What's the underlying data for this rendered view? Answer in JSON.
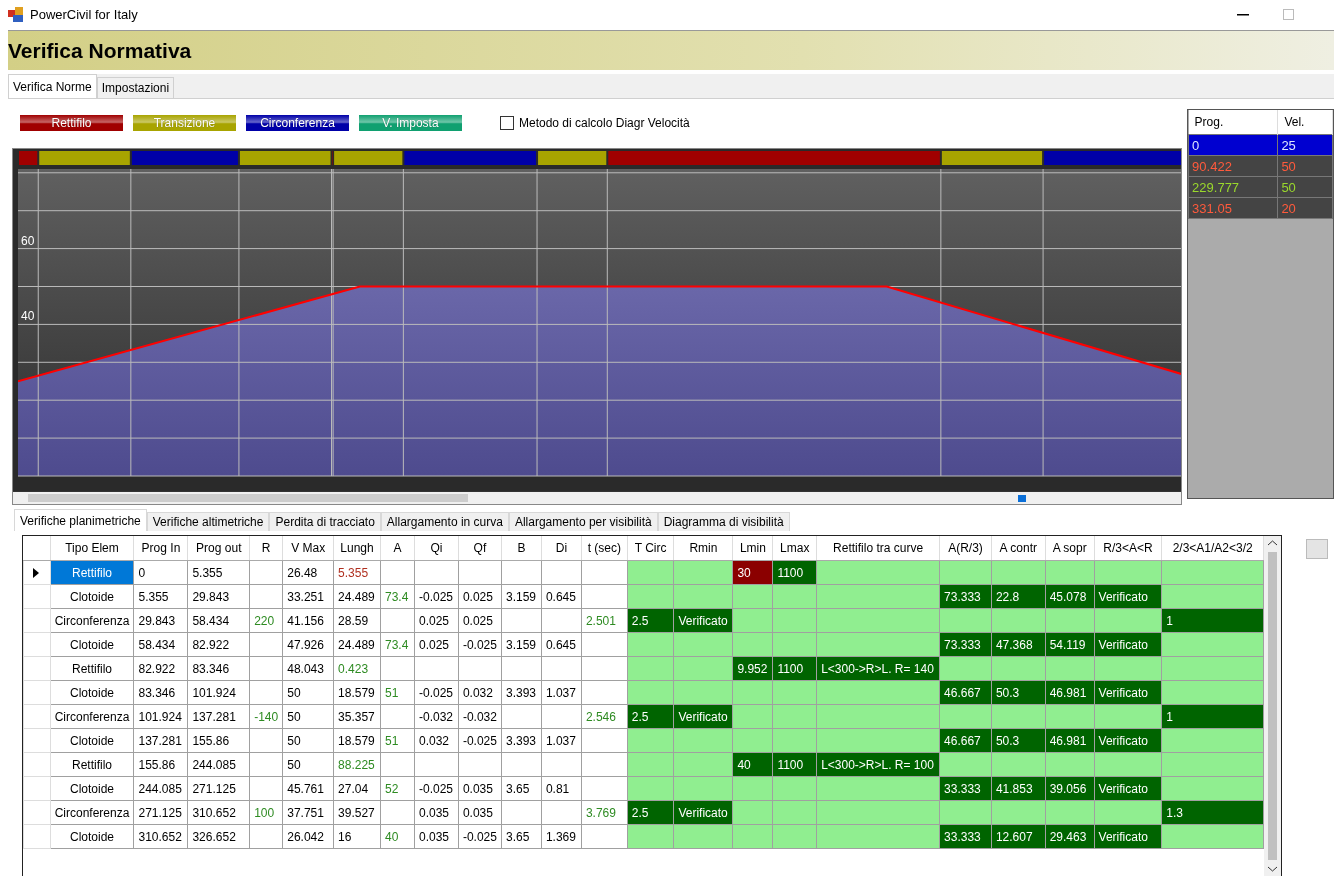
{
  "window": {
    "title": "PowerCivil for Italy"
  },
  "banner": {
    "title": "Verifica Normativa"
  },
  "tabs": [
    {
      "label": "Verifica Norme",
      "selected": true
    },
    {
      "label": "Impostazioni",
      "selected": false
    }
  ],
  "legend": [
    {
      "label": "Rettifilo",
      "color": "#a00000"
    },
    {
      "label": "Transizione",
      "color": "#a8a400"
    },
    {
      "label": "Circonferenza",
      "color": "#0000a8"
    },
    {
      "label": "V. Imposta",
      "color": "#10a070"
    }
  ],
  "speed_method": {
    "label": "Metodo di calcolo Diagr Velocità",
    "checked": false
  },
  "diagram": {
    "axis_labels": [
      "60",
      "40"
    ]
  },
  "speed_table": {
    "columns": [
      "Prog.",
      "Vel."
    ],
    "rows": [
      {
        "cells": [
          "0",
          "25"
        ],
        "selected": true
      },
      {
        "cells": [
          "90.422",
          "50"
        ],
        "selected": false,
        "color": "#ff5a3c"
      },
      {
        "cells": [
          "229.777",
          "50"
        ],
        "selected": false,
        "color": "#9ad82c"
      },
      {
        "cells": [
          "331.05",
          "20"
        ],
        "selected": false,
        "color": "#ff5a3c"
      }
    ]
  },
  "check_tabs": [
    {
      "label": "Verifiche planimetriche",
      "selected": true
    },
    {
      "label": "Verifiche altimetriche",
      "selected": false
    },
    {
      "label": "Perdita di tracciato",
      "selected": false
    },
    {
      "label": "Allargamento in curva",
      "selected": false
    },
    {
      "label": "Allargamento per visibilità",
      "selected": false
    },
    {
      "label": "Diagramma di visibilità",
      "selected": false
    }
  ],
  "table": {
    "columns": [
      {
        "label": "Tipo Elem",
        "kind": "data"
      },
      {
        "label": "Prog In",
        "kind": "data"
      },
      {
        "label": "Prog out",
        "kind": "data"
      },
      {
        "label": "R",
        "kind": "data"
      },
      {
        "label": "V Max",
        "kind": "data"
      },
      {
        "label": "Lungh",
        "kind": "data"
      },
      {
        "label": "A",
        "kind": "data"
      },
      {
        "label": "Qi",
        "kind": "data"
      },
      {
        "label": "Qf",
        "kind": "data"
      },
      {
        "label": "B",
        "kind": "data"
      },
      {
        "label": "Di",
        "kind": "data"
      },
      {
        "label": "t (sec)",
        "kind": "data"
      },
      {
        "label": "T Circ",
        "kind": "check"
      },
      {
        "label": "Rmin",
        "kind": "check"
      },
      {
        "label": "Lmin",
        "kind": "check"
      },
      {
        "label": "Lmax",
        "kind": "check"
      },
      {
        "label": "Rettifilo tra curve",
        "kind": "check"
      },
      {
        "label": "A(R/3)",
        "kind": "check"
      },
      {
        "label": "A contr",
        "kind": "check"
      },
      {
        "label": "A sopr",
        "kind": "check"
      },
      {
        "label": "R/3<A<R",
        "kind": "check"
      },
      {
        "label": "2/3<A1/A2<3/2",
        "kind": "check"
      }
    ],
    "rows": [
      {
        "kind": "straight",
        "selected": true,
        "cells": [
          {
            "text": "Rettifilo"
          },
          {
            "text": "0"
          },
          {
            "text": "5.355"
          },
          {},
          {
            "text": "26.48"
          },
          {
            "text": "5.355",
            "color": "#b03020"
          },
          {},
          {},
          {},
          {},
          {},
          {},
          {},
          {},
          {
            "text": "30",
            "passed": false
          },
          {
            "text": "1100",
            "passed": true
          },
          {},
          {},
          {},
          {},
          {},
          {}
        ]
      },
      {
        "kind": "transition",
        "selected": false,
        "cells": [
          {
            "text": "Clotoide"
          },
          {
            "text": "5.355"
          },
          {
            "text": "29.843"
          },
          {},
          {
            "text": "33.251"
          },
          {
            "text": "24.489"
          },
          {
            "text": "73.4",
            "color": "#2e8b22"
          },
          {
            "text": "-0.025"
          },
          {
            "text": "0.025"
          },
          {
            "text": "3.159"
          },
          {
            "text": "0.645"
          },
          {},
          {},
          {},
          {},
          {},
          {},
          {
            "text": "73.333",
            "passed": true
          },
          {
            "text": "22.8",
            "passed": true
          },
          {
            "text": "45.078",
            "passed": true
          },
          {
            "text": "Verificato",
            "passed": true
          },
          {}
        ]
      },
      {
        "kind": "circle",
        "selected": false,
        "cells": [
          {
            "text": "Circonferenza"
          },
          {
            "text": "29.843"
          },
          {
            "text": "58.434"
          },
          {
            "text": "220",
            "color": "#2e8b22"
          },
          {
            "text": "41.156"
          },
          {
            "text": "28.59"
          },
          {},
          {
            "text": "0.025"
          },
          {
            "text": "0.025"
          },
          {},
          {},
          {
            "text": "2.501",
            "color": "#2e8b22"
          },
          {
            "text": "2.5",
            "passed": true
          },
          {
            "text": "Verificato",
            "passed": true
          },
          {},
          {},
          {},
          {},
          {},
          {},
          {},
          {
            "text": "1",
            "passed": true
          }
        ]
      },
      {
        "kind": "transition",
        "selected": false,
        "cells": [
          {
            "text": "Clotoide"
          },
          {
            "text": "58.434"
          },
          {
            "text": "82.922"
          },
          {},
          {
            "text": "47.926"
          },
          {
            "text": "24.489"
          },
          {
            "text": "73.4",
            "color": "#2e8b22"
          },
          {
            "text": "0.025"
          },
          {
            "text": "-0.025"
          },
          {
            "text": "3.159"
          },
          {
            "text": "0.645"
          },
          {},
          {},
          {},
          {},
          {},
          {},
          {
            "text": "73.333",
            "passed": true
          },
          {
            "text": "47.368",
            "passed": true
          },
          {
            "text": "54.119",
            "passed": true
          },
          {
            "text": "Verificato",
            "passed": true
          },
          {}
        ]
      },
      {
        "kind": "straight",
        "selected": false,
        "cells": [
          {
            "text": "Rettifilo"
          },
          {
            "text": "82.922"
          },
          {
            "text": "83.346"
          },
          {},
          {
            "text": "48.043"
          },
          {
            "text": "0.423",
            "color": "#2e8b22"
          },
          {},
          {},
          {},
          {},
          {},
          {},
          {},
          {},
          {
            "text": "9.952",
            "passed": true
          },
          {
            "text": "1100",
            "passed": true
          },
          {
            "text": "L<300->R>L. R= 140",
            "passed": true
          },
          {},
          {},
          {},
          {},
          {}
        ]
      },
      {
        "kind": "transition",
        "selected": false,
        "cells": [
          {
            "text": "Clotoide"
          },
          {
            "text": "83.346"
          },
          {
            "text": "101.924"
          },
          {},
          {
            "text": "50"
          },
          {
            "text": "18.579"
          },
          {
            "text": "51",
            "color": "#2e8b22"
          },
          {
            "text": "-0.025"
          },
          {
            "text": "0.032"
          },
          {
            "text": "3.393"
          },
          {
            "text": "1.037"
          },
          {},
          {},
          {},
          {},
          {},
          {},
          {
            "text": "46.667",
            "passed": true
          },
          {
            "text": "50.3",
            "passed": true
          },
          {
            "text": "46.981",
            "passed": true
          },
          {
            "text": "Verificato",
            "passed": true
          },
          {}
        ]
      },
      {
        "kind": "circle",
        "selected": false,
        "cells": [
          {
            "text": "Circonferenza"
          },
          {
            "text": "101.924"
          },
          {
            "text": "137.281"
          },
          {
            "text": "-140",
            "color": "#2e8b22"
          },
          {
            "text": "50"
          },
          {
            "text": "35.357"
          },
          {},
          {
            "text": "-0.032"
          },
          {
            "text": "-0.032"
          },
          {},
          {},
          {
            "text": "2.546",
            "color": "#2e8b22"
          },
          {
            "text": "2.5",
            "passed": true
          },
          {
            "text": "Verificato",
            "passed": true
          },
          {},
          {},
          {},
          {},
          {},
          {},
          {},
          {
            "text": "1",
            "passed": true
          }
        ]
      },
      {
        "kind": "transition",
        "selected": false,
        "cells": [
          {
            "text": "Clotoide"
          },
          {
            "text": "137.281"
          },
          {
            "text": "155.86"
          },
          {},
          {
            "text": "50"
          },
          {
            "text": "18.579"
          },
          {
            "text": "51",
            "color": "#2e8b22"
          },
          {
            "text": "0.032"
          },
          {
            "text": "-0.025"
          },
          {
            "text": "3.393"
          },
          {
            "text": "1.037"
          },
          {},
          {},
          {},
          {},
          {},
          {},
          {
            "text": "46.667",
            "passed": true
          },
          {
            "text": "50.3",
            "passed": true
          },
          {
            "text": "46.981",
            "passed": true
          },
          {
            "text": "Verificato",
            "passed": true
          },
          {}
        ]
      },
      {
        "kind": "straight",
        "selected": false,
        "cells": [
          {
            "text": "Rettifilo"
          },
          {
            "text": "155.86"
          },
          {
            "text": "244.085"
          },
          {},
          {
            "text": "50"
          },
          {
            "text": "88.225",
            "color": "#2e8b22"
          },
          {},
          {},
          {},
          {},
          {},
          {},
          {},
          {},
          {
            "text": "40",
            "passed": true
          },
          {
            "text": "1100",
            "passed": true
          },
          {
            "text": "L<300->R>L. R= 100",
            "passed": true
          },
          {},
          {},
          {},
          {},
          {}
        ]
      },
      {
        "kind": "transition",
        "selected": false,
        "cells": [
          {
            "text": "Clotoide"
          },
          {
            "text": "244.085"
          },
          {
            "text": "271.125"
          },
          {},
          {
            "text": "45.761"
          },
          {
            "text": "27.04"
          },
          {
            "text": "52",
            "color": "#2e8b22"
          },
          {
            "text": "-0.025"
          },
          {
            "text": "0.035"
          },
          {
            "text": "3.65"
          },
          {
            "text": "0.81"
          },
          {},
          {},
          {},
          {},
          {},
          {},
          {
            "text": "33.333",
            "passed": true
          },
          {
            "text": "41.853",
            "passed": true
          },
          {
            "text": "39.056",
            "passed": true
          },
          {
            "text": "Verificato",
            "passed": true
          },
          {}
        ]
      },
      {
        "kind": "circle",
        "selected": false,
        "cells": [
          {
            "text": "Circonferenza"
          },
          {
            "text": "271.125"
          },
          {
            "text": "310.652"
          },
          {
            "text": "100",
            "color": "#2e8b22"
          },
          {
            "text": "37.751"
          },
          {
            "text": "39.527"
          },
          {},
          {
            "text": "0.035"
          },
          {
            "text": "0.035"
          },
          {},
          {},
          {
            "text": "3.769",
            "color": "#2e8b22"
          },
          {
            "text": "2.5",
            "passed": true
          },
          {
            "text": "Verificato",
            "passed": true
          },
          {},
          {},
          {},
          {},
          {},
          {},
          {},
          {
            "text": "1.3",
            "passed": true
          }
        ]
      },
      {
        "selected": false,
        "cells": [
          {
            "text": "Clotoide"
          },
          {
            "text": "310.652"
          },
          {
            "text": "326.652"
          },
          {},
          {
            "text": "26.042"
          },
          {
            "text": "16"
          },
          {
            "text": "40",
            "color": "#2e8b22"
          },
          {
            "text": "0.035"
          },
          {
            "text": "-0.025"
          },
          {
            "text": "3.65"
          },
          {
            "text": "1.369"
          },
          {},
          {},
          {},
          {},
          {},
          {},
          {
            "text": "33.333",
            "passed": true
          },
          {
            "text": "12.607",
            "passed": true
          },
          {
            "text": "29.463",
            "passed": true
          },
          {
            "text": "Verificato",
            "passed": true
          },
          {}
        ]
      }
    ]
  }
}
